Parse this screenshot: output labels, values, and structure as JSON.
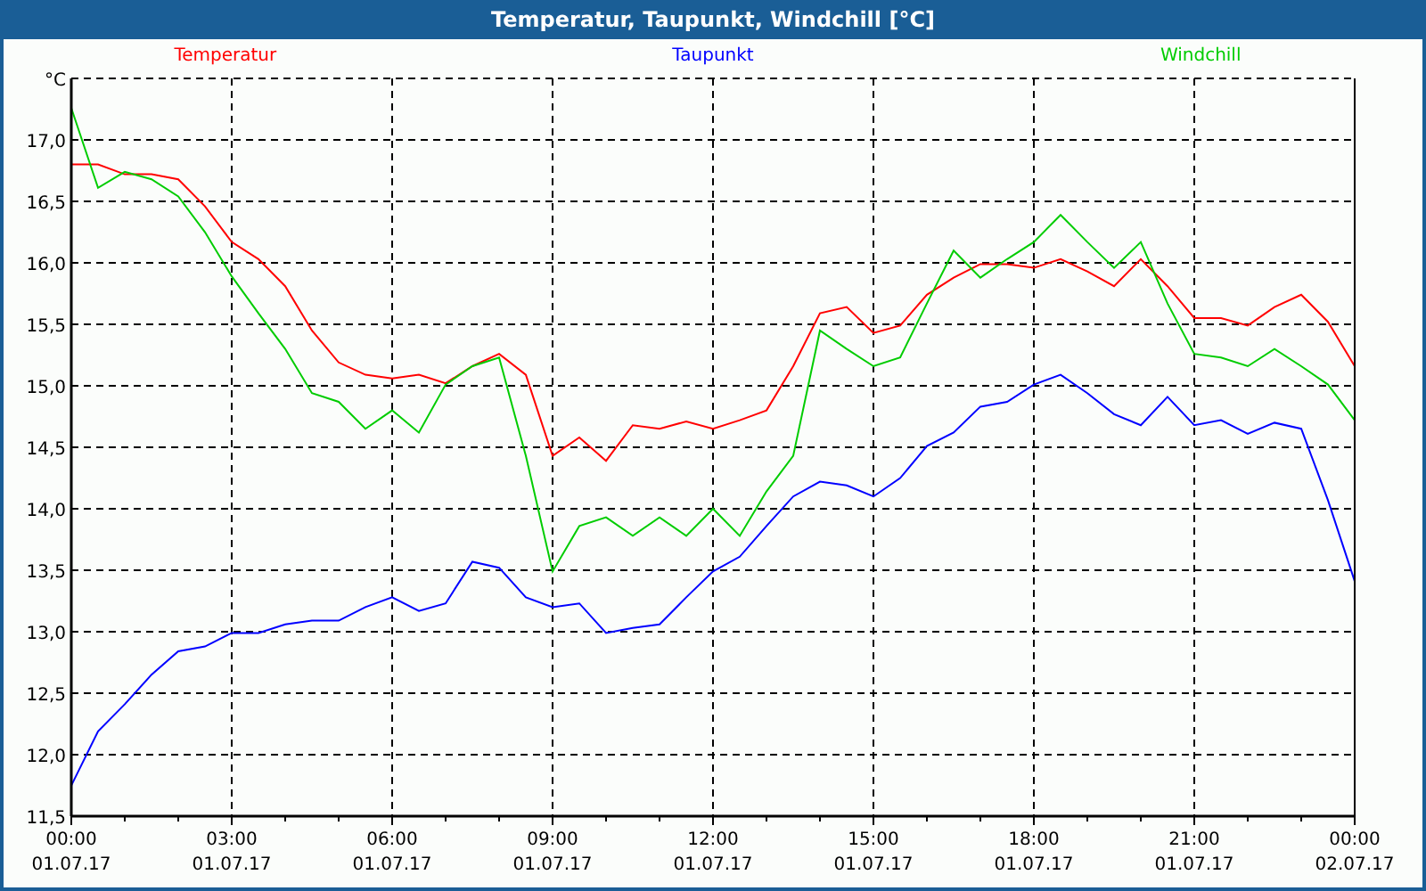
{
  "window": {
    "title": "Temperatur, Taupunkt, Windchill [°C]"
  },
  "chart": {
    "chart_data": {
      "type": "line",
      "grid": true,
      "ylabel": "°C",
      "categories": [
        "00:00 01.07.17",
        null,
        null,
        null,
        null,
        null,
        "03:00 01.07.17",
        null,
        null,
        null,
        null,
        null,
        "06:00 01.07.17",
        null,
        null,
        null,
        null,
        null,
        "09:00 01.07.17",
        null,
        null,
        null,
        null,
        null,
        "12:00 01.07.17",
        null,
        null,
        null,
        null,
        null,
        "15:00 01.07.17",
        null,
        null,
        null,
        null,
        null,
        "18:00 01.07.17",
        null,
        null,
        null,
        null,
        null,
        "21:00 01.07.17",
        null,
        null,
        null,
        null,
        null,
        "00:00 02.07.17"
      ],
      "ylim": [
        11.5,
        17.5
      ],
      "yticks": [
        {
          "value": 11.5,
          "label": "11,5"
        },
        {
          "value": 12,
          "label": "12,0"
        },
        {
          "value": 12.5,
          "label": "12,5"
        },
        {
          "value": 13,
          "label": "13,0"
        },
        {
          "value": 13.5,
          "label": "13,5"
        },
        {
          "value": 14,
          "label": "14,0"
        },
        {
          "value": 14.5,
          "label": "14,5"
        },
        {
          "value": 15,
          "label": "15,0"
        },
        {
          "value": 15.5,
          "label": "15,5"
        },
        {
          "value": 16,
          "label": "16,0"
        },
        {
          "value": 16.5,
          "label": "16,5"
        },
        {
          "value": 17,
          "label": "17,0"
        }
      ],
      "series": [
        {
          "name": "Temperatur",
          "color": "#ff0000",
          "values": [
            16.8,
            16.8,
            16.72,
            16.72,
            16.68,
            16.46,
            16.17,
            16.03,
            15.81,
            15.45,
            15.19,
            15.09,
            15.06,
            15.09,
            15.02,
            15.16,
            15.26,
            15.09,
            14.43,
            14.58,
            14.39,
            14.68,
            14.65,
            14.71,
            14.65,
            14.72,
            14.8,
            15.16,
            15.59,
            15.64,
            15.43,
            15.49,
            15.74,
            15.88,
            15.99,
            15.99,
            15.96,
            16.03,
            15.93,
            15.81,
            16.03,
            15.81,
            15.55,
            15.55,
            15.49,
            15.64,
            15.74,
            15.52,
            15.16
          ]
        },
        {
          "name": "Taupunkt",
          "color": "#0000ff",
          "values": [
            11.75,
            12.19,
            12.41,
            12.65,
            12.84,
            12.88,
            12.99,
            12.99,
            13.06,
            13.09,
            13.09,
            13.2,
            13.28,
            13.17,
            13.23,
            13.57,
            13.52,
            13.28,
            13.2,
            13.23,
            12.99,
            13.03,
            13.06,
            13.28,
            13.49,
            13.61,
            13.86,
            14.1,
            14.22,
            14.19,
            14.1,
            14.25,
            14.51,
            14.62,
            14.83,
            14.87,
            15.01,
            15.09,
            14.94,
            14.77,
            14.68,
            14.91,
            14.68,
            14.72,
            14.61,
            14.7,
            14.65,
            14.07,
            13.41
          ]
        },
        {
          "name": "Windchill",
          "color": "#00cc00",
          "values": [
            17.26,
            16.61,
            16.74,
            16.68,
            16.54,
            16.25,
            15.89,
            15.59,
            15.3,
            14.94,
            14.87,
            14.65,
            14.8,
            14.62,
            15.01,
            15.16,
            15.23,
            14.43,
            13.49,
            13.86,
            13.93,
            13.78,
            13.93,
            13.78,
            14.0,
            13.78,
            14.14,
            14.43,
            15.45,
            15.3,
            15.16,
            15.23,
            15.67,
            16.1,
            15.88,
            16.03,
            16.17,
            16.39,
            16.17,
            15.96,
            16.17,
            15.67,
            15.26,
            15.23,
            15.16,
            15.3,
            15.16,
            15.01,
            14.72
          ]
        }
      ]
    }
  }
}
